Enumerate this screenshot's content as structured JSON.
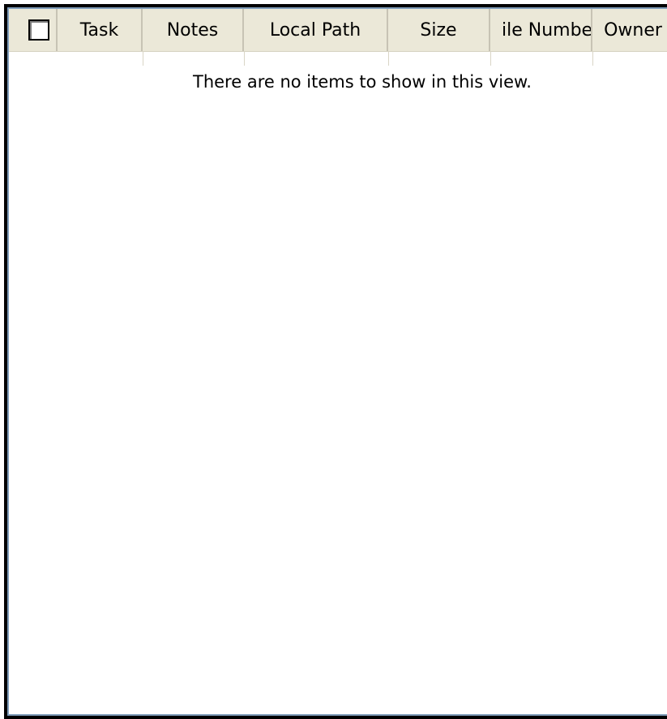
{
  "listview": {
    "columns": [
      {
        "label": "Task"
      },
      {
        "label": "Notes"
      },
      {
        "label": "Local Path"
      },
      {
        "label": "Size"
      },
      {
        "label": "ile Numbe"
      },
      {
        "label": "Owner"
      }
    ],
    "select_all_checked": false,
    "empty_message": "There are no items to show in this view."
  },
  "colors": {
    "header_bg": "#ebe8d8",
    "border": "#7f9db9",
    "frame": "#000000"
  }
}
